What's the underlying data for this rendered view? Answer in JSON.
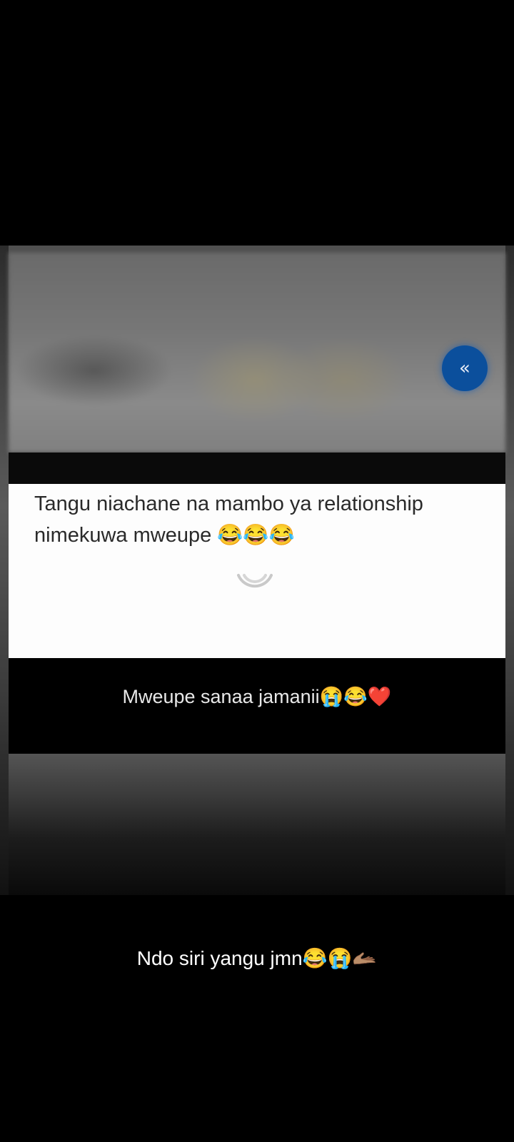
{
  "photo": {
    "back_button_glyph": "«",
    "back_button_icon": "chevrons-left-icon",
    "back_button_color": "#0b4f9c",
    "post_text": "Tangu niachane na mambo ya relationship nimekuwa mweupe 😂😂😂",
    "inner_caption": "Mweupe sanaa jamanii😭😂❤️",
    "spinner_icon": "loading-spinner-icon"
  },
  "caption": {
    "text": "Ndo siri yangu jmn😂😭🫴🏽"
  }
}
